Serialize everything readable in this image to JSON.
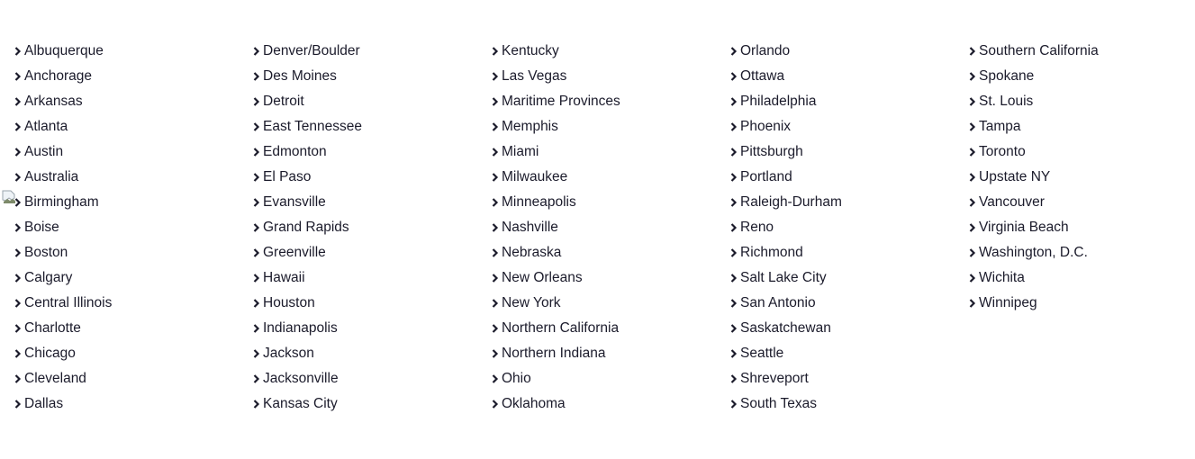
{
  "icons": {
    "item_icon": "chevron-right-icon",
    "broken_image": "broken-image-icon"
  },
  "columns": [
    [
      "Albuquerque",
      "Anchorage",
      "Arkansas",
      "Atlanta",
      "Austin",
      "Australia",
      "Birmingham",
      "Boise",
      "Boston",
      "Calgary",
      "Central Illinois",
      "Charlotte",
      "Chicago",
      "Cleveland",
      "Dallas"
    ],
    [
      "Denver/Boulder",
      "Des Moines",
      "Detroit",
      "East Tennessee",
      "Edmonton",
      "El Paso",
      "Evansville",
      "Grand Rapids",
      "Greenville",
      "Hawaii",
      "Houston",
      "Indianapolis",
      "Jackson",
      "Jacksonville",
      "Kansas City"
    ],
    [
      "Kentucky",
      "Las Vegas",
      "Maritime Provinces",
      "Memphis",
      "Miami",
      "Milwaukee",
      "Minneapolis",
      "Nashville",
      "Nebraska",
      "New Orleans",
      "New York",
      "Northern California",
      "Northern Indiana",
      "Ohio",
      "Oklahoma"
    ],
    [
      "Orlando",
      "Ottawa",
      "Philadelphia",
      "Phoenix",
      "Pittsburgh",
      "Portland",
      "Raleigh-Durham",
      "Reno",
      "Richmond",
      "Salt Lake City",
      "San Antonio",
      "Saskatchewan",
      "Seattle",
      "Shreveport",
      "South Texas"
    ],
    [
      "Southern California",
      "Spokane",
      "St. Louis",
      "Tampa",
      "Toronto",
      "Upstate NY",
      "Vancouver",
      "Virginia Beach",
      "Washington, D.C.",
      "Wichita",
      "Winnipeg"
    ]
  ]
}
